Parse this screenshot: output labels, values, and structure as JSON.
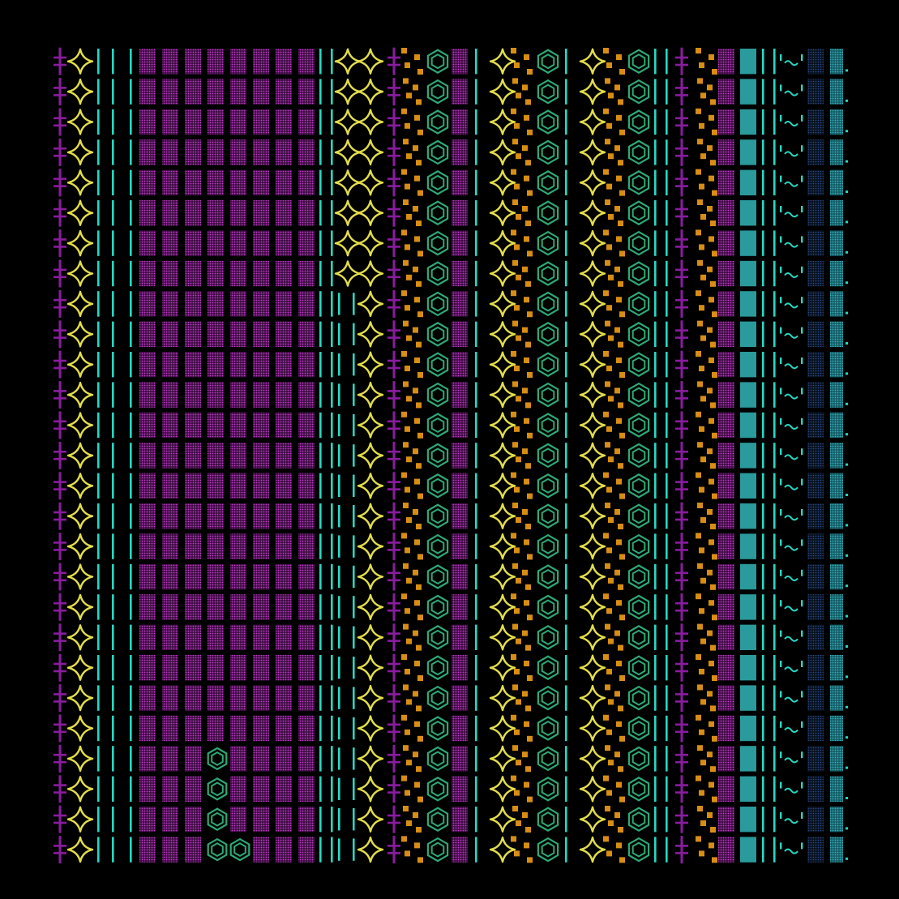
{
  "colors": {
    "background": "#000000",
    "magenta": "#8a1ca0",
    "magenta_dots": "#c03ec8",
    "yellow": "#e3de4a",
    "cyan": "#27d8c2",
    "green": "#2fa876",
    "orange": "#d88d14",
    "teal_block": "#2a9a9c",
    "teal_dots": "#2b8fa0",
    "blue_dots": "#2d4a8a"
  },
  "grid": {
    "rows": 27
  },
  "columns": [
    {
      "kind": "plus",
      "color": "magenta"
    },
    {
      "kind": "sparkle",
      "color": "yellow"
    },
    {
      "kind": "bars3",
      "color": "cyan"
    },
    {
      "kind": "dotblocks",
      "color": "magenta_dots",
      "count": 8
    },
    {
      "kind": "bars2",
      "color": "cyan"
    },
    {
      "kind": "sparkle_pair",
      "color": "yellow"
    },
    {
      "kind": "plus",
      "color": "magenta"
    },
    {
      "kind": "orange_dots",
      "color": "orange"
    },
    {
      "kind": "hexagon",
      "color": "green"
    },
    {
      "kind": "dotblocks",
      "color": "magenta_dots",
      "count": 1
    },
    {
      "kind": "bar1",
      "color": "cyan"
    },
    {
      "kind": "sparkle",
      "color": "yellow"
    },
    {
      "kind": "orange_dots",
      "color": "orange"
    },
    {
      "kind": "hexagon",
      "color": "green"
    },
    {
      "kind": "bar1",
      "color": "cyan"
    },
    {
      "kind": "sparkle",
      "color": "yellow"
    },
    {
      "kind": "orange_dots",
      "color": "orange"
    },
    {
      "kind": "hexagon",
      "color": "green"
    },
    {
      "kind": "bars2",
      "color": "cyan"
    },
    {
      "kind": "plus",
      "color": "magenta"
    },
    {
      "kind": "orange_dots",
      "color": "orange"
    },
    {
      "kind": "dotblocks",
      "color": "magenta_dots",
      "count": 1
    },
    {
      "kind": "teal_block",
      "color": "teal_block"
    },
    {
      "kind": "bars2",
      "color": "cyan"
    },
    {
      "kind": "tilde",
      "color": "cyan"
    },
    {
      "kind": "dotblocks",
      "color": "blue_dots",
      "count": 1
    },
    {
      "kind": "teal_block_dots",
      "color": "teal_dots"
    }
  ]
}
